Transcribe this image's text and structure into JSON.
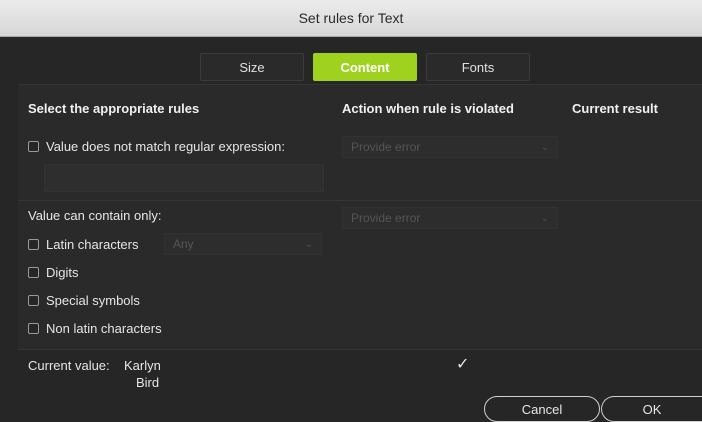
{
  "window": {
    "title": "Set rules for Text"
  },
  "tabs": [
    {
      "label": "Size",
      "active": false
    },
    {
      "label": "Content",
      "active": true
    },
    {
      "label": "Fonts",
      "active": false
    }
  ],
  "columns": {
    "rules": "Select the appropriate rules",
    "action": "Action when rule is violated",
    "result": "Current result"
  },
  "rules": {
    "regex": {
      "label": "Value does not match regular expression:",
      "checked": false,
      "value": "",
      "action": "Provide error"
    },
    "contain_only": {
      "label": "Value can contain only:",
      "action": "Provide error",
      "latin": {
        "label": "Latin characters",
        "checked": false,
        "option": "Any"
      },
      "digits": {
        "label": "Digits",
        "checked": false
      },
      "special": {
        "label": "Special symbols",
        "checked": false
      },
      "non_latin": {
        "label": "Non latin characters",
        "checked": false
      }
    }
  },
  "current": {
    "label": "Current value:",
    "value_line1": "Karlyn",
    "value_line2": "Bird",
    "result_mark": "✓"
  },
  "buttons": {
    "cancel": "Cancel",
    "ok": "OK"
  },
  "colors": {
    "accent": "#9fd21e",
    "background": "#262626",
    "title_bar": "#e0e0e0"
  }
}
